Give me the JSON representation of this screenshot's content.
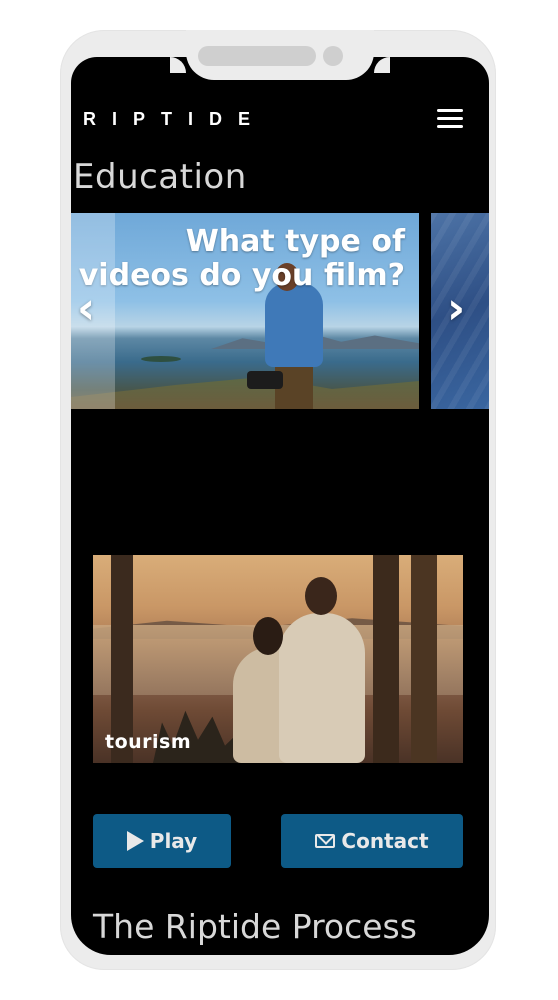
{
  "header": {
    "brand": "RIPTIDE",
    "menu_icon": "hamburger-menu-icon"
  },
  "education": {
    "title": "Education",
    "carousel": {
      "slides": [
        {
          "caption": "What type of videos do you film?"
        }
      ],
      "prev_icon": "chevron-left-icon",
      "next_icon": "chevron-right-icon"
    }
  },
  "feature": {
    "label": "tourism"
  },
  "actions": {
    "play_label": "Play",
    "play_icon": "play-icon",
    "contact_label": "Contact",
    "contact_icon": "envelope-icon"
  },
  "process": {
    "title": "The Riptide Process"
  },
  "colors": {
    "background": "#000000",
    "button": "#0d5a86",
    "title_text": "#d8d8d8",
    "device_frame": "#ececec"
  }
}
